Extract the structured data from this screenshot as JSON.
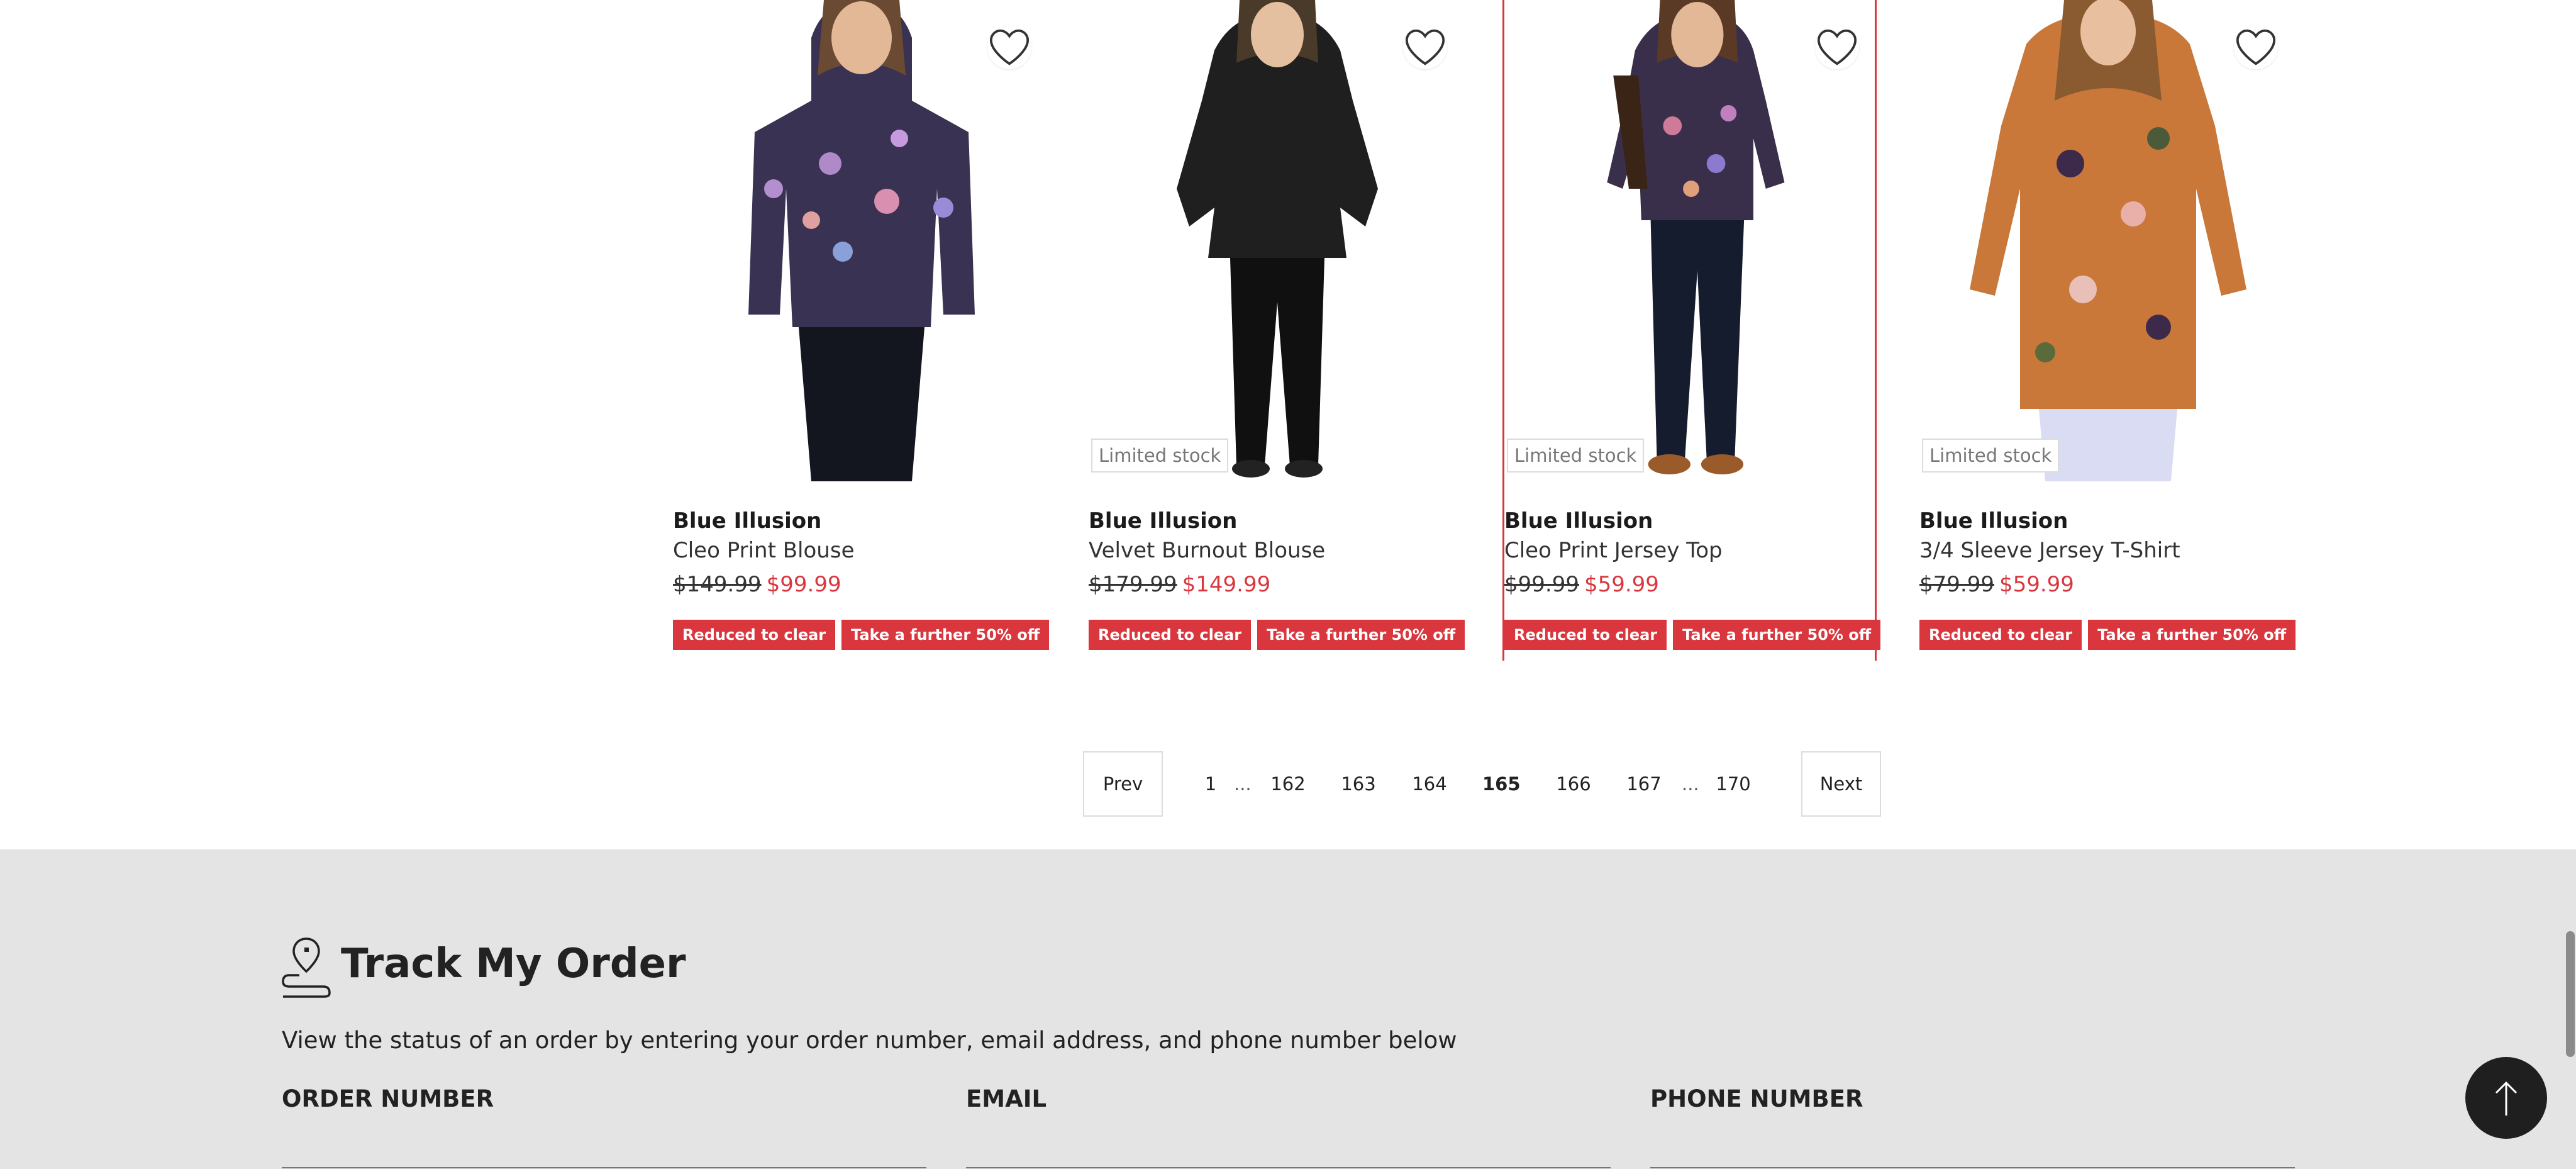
{
  "products": [
    {
      "brand": "Blue Illusion",
      "name": "Cleo Print Blouse",
      "was_price": "$149.99",
      "now_price": "$99.99",
      "limited_stock": "",
      "tags": [
        "Reduced to clear",
        "Take a further 50% off"
      ]
    },
    {
      "brand": "Blue Illusion",
      "name": "Velvet Burnout Blouse",
      "was_price": "$179.99",
      "now_price": "$149.99",
      "limited_stock": "Limited stock",
      "tags": [
        "Reduced to clear",
        "Take a further 50% off"
      ]
    },
    {
      "brand": "Blue Illusion",
      "name": "Cleo Print Jersey Top",
      "was_price": "$99.99",
      "now_price": "$59.99",
      "limited_stock": "Limited stock",
      "tags": [
        "Reduced to clear",
        "Take a further 50% off"
      ]
    },
    {
      "brand": "Blue Illusion",
      "name": "3/4 Sleeve Jersey T-Shirt",
      "was_price": "$79.99",
      "now_price": "$59.99",
      "limited_stock": "Limited stock",
      "tags": [
        "Reduced to clear",
        "Take a further 50% off"
      ]
    }
  ],
  "pagination": {
    "prev": "Prev",
    "next": "Next",
    "pages": [
      "1",
      "162",
      "163",
      "164",
      "165",
      "166",
      "167",
      "170"
    ],
    "ellipsis": "...",
    "current": "165"
  },
  "track_order": {
    "title": "Track My Order",
    "description": "View the status of an order by entering your order number, email address, and phone number below",
    "order_number_label": "ORDER NUMBER",
    "email_label": "EMAIL",
    "phone_label": "PHONE NUMBER"
  },
  "icons": {
    "wishlist": "heart-icon",
    "track": "location-pin-icon",
    "back_to_top": "arrow-up-icon"
  },
  "colors": {
    "accent": "#d9363e",
    "track_background": "#e4e4e4"
  }
}
